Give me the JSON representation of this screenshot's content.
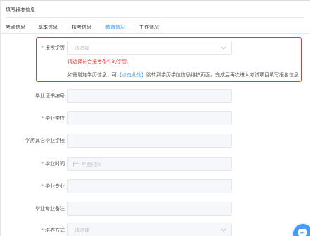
{
  "page": {
    "title": "填写报考信息"
  },
  "tabs": [
    {
      "label": "考点信息"
    },
    {
      "label": "基本信息"
    },
    {
      "label": "报考信息"
    },
    {
      "label": "教育情况",
      "active": true
    },
    {
      "label": "工作情况"
    }
  ],
  "form": {
    "education_level": {
      "label": "报考学历",
      "placeholder": "请选择",
      "required": true
    },
    "error_message": "请选择符合报考条件的学历;",
    "tip": {
      "prefix": "如需增加学历信息，可",
      "link": "【点击此处】",
      "suffix": "跳转到学历学位信息维护页面。完成后再次进入考试项目填写报名信息"
    },
    "cert_number": {
      "label": "毕业证书编号",
      "value": ""
    },
    "school": {
      "label": "毕业学校",
      "required": true,
      "value": ""
    },
    "other_school": {
      "label": "学历其它毕业学校",
      "value": ""
    },
    "grad_time": {
      "label": "毕业时间",
      "required": true,
      "placeholder": "毕业时间"
    },
    "major": {
      "label": "毕业专业",
      "required": true,
      "value": ""
    },
    "major_note": {
      "label": "毕业专业备注",
      "value": ""
    },
    "training_mode": {
      "label": "培养方式",
      "required": true,
      "placeholder": "请选择"
    }
  },
  "colors": {
    "accent": "#409eff",
    "error": "#e53935",
    "required": "#f56c6c"
  },
  "icons": [
    "chevron-down-icon",
    "calendar-icon",
    "chat-icon"
  ]
}
